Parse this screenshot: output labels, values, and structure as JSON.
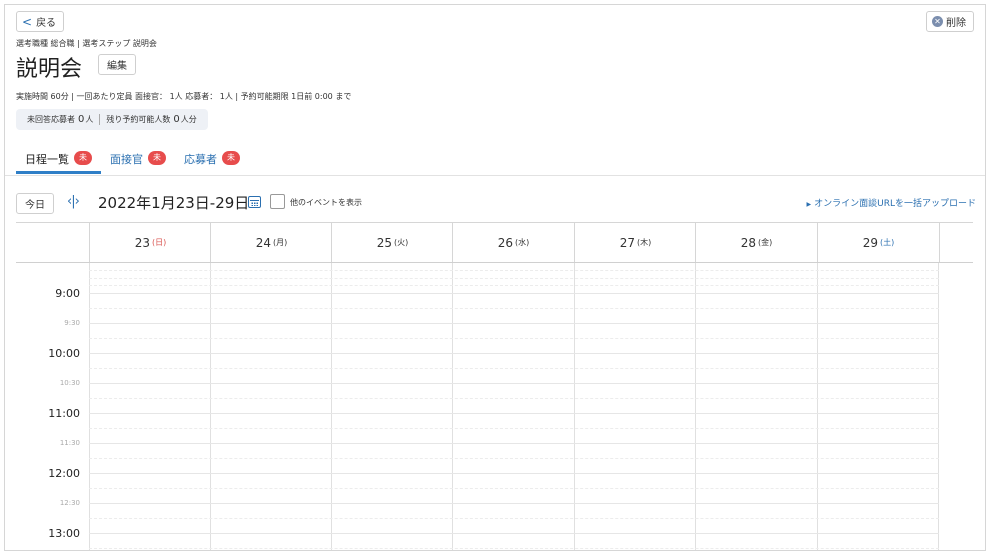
{
  "header": {
    "back_label": "戻る",
    "delete_label": "削除",
    "breadcrumb": "選考職種 総合職 | 選考ステップ 説明会",
    "title": "説明会",
    "edit_label": "編集",
    "meta": "実施時間 60分 | 一回あたり定員 面接官： 1人 応募者： 1人 | 予約可能期限 1日前 0:00 まで"
  },
  "stats": {
    "unanswered_label": "未回答応募者",
    "unanswered_value": "0",
    "unanswered_unit": "人",
    "remaining_label": "残り予約可能人数",
    "remaining_value": "0",
    "remaining_unit": "人分"
  },
  "tabs": [
    {
      "label": "日程一覧",
      "badge": "未"
    },
    {
      "label": "面接官",
      "badge": "未"
    },
    {
      "label": "応募者",
      "badge": "未"
    }
  ],
  "toolbar": {
    "today_label": "今日",
    "nav_symbol": "‹|›",
    "range": "2022年1月23日-29日",
    "show_other_events": "他のイベントを表示",
    "upload_link": "オンライン面談URLを一括アップロード"
  },
  "days": [
    {
      "num": "23",
      "dow": "(日)"
    },
    {
      "num": "24",
      "dow": "(月)"
    },
    {
      "num": "25",
      "dow": "(火)"
    },
    {
      "num": "26",
      "dow": "(水)"
    },
    {
      "num": "27",
      "dow": "(木)"
    },
    {
      "num": "28",
      "dow": "(金)"
    },
    {
      "num": "29",
      "dow": "(土)"
    }
  ],
  "times": [
    "9:00",
    "9:30",
    "10:00",
    "10:30",
    "11:00",
    "11:30",
    "12:00",
    "12:30",
    "13:00"
  ],
  "colors": {
    "accent": "#2f7fc7",
    "link": "#2a6fb0",
    "badge": "#e74c4c",
    "sunday": "#d9534f",
    "saturday": "#2a6fb0"
  }
}
